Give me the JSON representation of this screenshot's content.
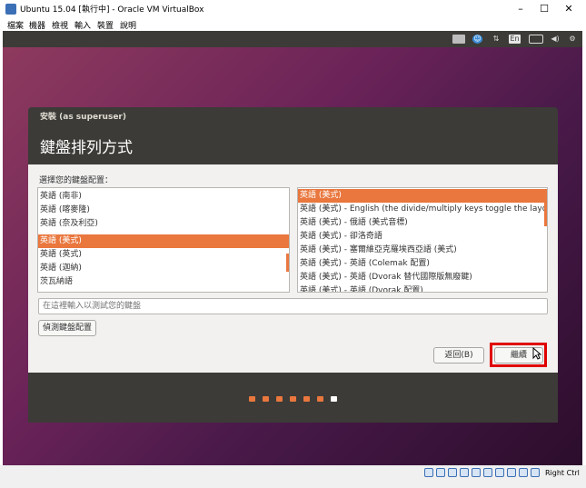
{
  "host_window": {
    "title": "Ubuntu 15.04 [執行中] - Oracle VM VirtualBox",
    "minimize": "–",
    "maximize": "☐",
    "close": "✕",
    "menu": [
      "檔案",
      "機器",
      "檢視",
      "輸入",
      "裝置",
      "說明"
    ],
    "host_key": "Right Ctrl"
  },
  "ubuntu_panel": {
    "icons": [
      "keyboard-icon",
      "accessibility-icon",
      "network-icon",
      "language-icon",
      "battery-icon",
      "volume-icon",
      "power-icon"
    ],
    "language": "En"
  },
  "installer": {
    "window_title": "安裝 (as superuser)",
    "heading": "鍵盤排列方式",
    "prompt": "選擇您的鍵盤配置：",
    "layouts": [
      "英語 (南非)",
      "英語 (喀麥隆)",
      "英語 (奈及利亞)",
      "英語 (美式)",
      "英語 (英式)",
      "英語 (迦納)",
      "茨瓦納語"
    ],
    "selected_layout": "英語 (美式)",
    "variants": [
      "英語 (美式)",
      "英語 (美式) - English (the divide/multiply keys toggle the layout)",
      "英語 (美式) - 俄語 (美式音標)",
      "英語 (美式) - 卻洛奇語",
      "英語 (美式) - 塞爾維亞克羅埃西亞語 (美式)",
      "英語 (美式) - 英語 (Colemak 配置)",
      "英語 (美式) - 英語 (Dvorak 替代國際版無廢鍵)",
      "英語 (美式) - 英語 (Dvorak 配置)"
    ],
    "selected_variant": "英語 (美式)",
    "test_placeholder": "在這裡輸入以測試您的鍵盤",
    "detect_button": "偵測鍵盤配置",
    "back_button": "返回(B)",
    "continue_button": "繼續"
  },
  "progress": {
    "total_steps": 7,
    "current_step": 7
  },
  "colors": {
    "accent": "#e9773e",
    "panel": "#3c3b37",
    "highlight": "#e00000"
  }
}
